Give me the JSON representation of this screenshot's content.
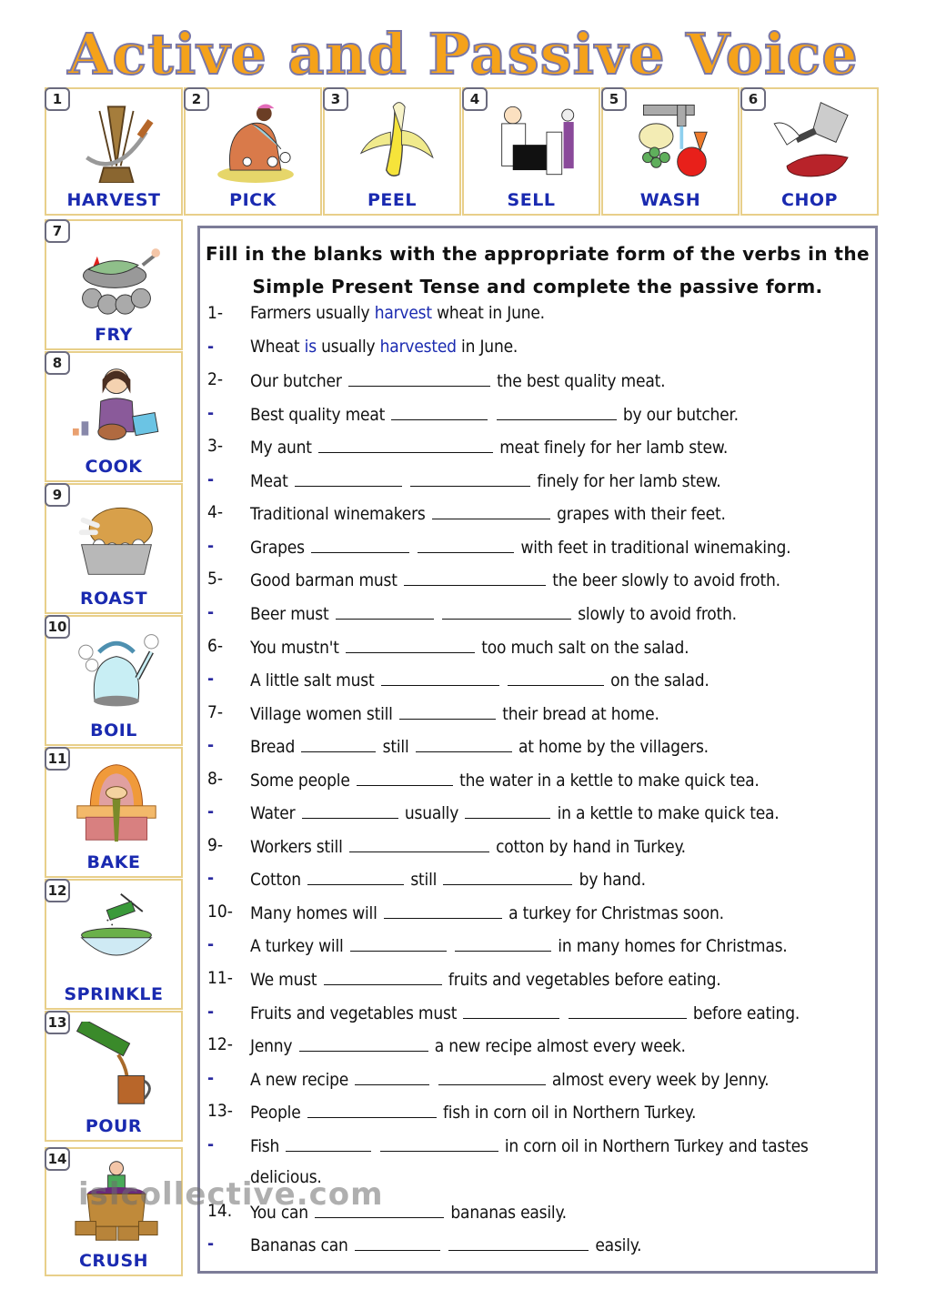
{
  "title": "Active and Passive Voice",
  "cards": [
    {
      "num": "1",
      "label": "HARVEST",
      "icon": "wheat-sickle-icon"
    },
    {
      "num": "2",
      "label": "PICK",
      "icon": "cotton-picker-icon"
    },
    {
      "num": "3",
      "label": "PEEL",
      "icon": "banana-icon"
    },
    {
      "num": "4",
      "label": "SELL",
      "icon": "butcher-shop-icon"
    },
    {
      "num": "5",
      "label": "WASH",
      "icon": "tap-vegetables-icon"
    },
    {
      "num": "6",
      "label": "CHOP",
      "icon": "cleaver-meat-icon"
    },
    {
      "num": "7",
      "label": "FRY",
      "icon": "frying-pan-fish-icon"
    },
    {
      "num": "8",
      "label": "COOK",
      "icon": "woman-cooking-icon"
    },
    {
      "num": "9",
      "label": "ROAST",
      "icon": "roast-turkey-icon"
    },
    {
      "num": "10",
      "label": "BOIL",
      "icon": "kettle-icon"
    },
    {
      "num": "11",
      "label": "BAKE",
      "icon": "oven-icon"
    },
    {
      "num": "12",
      "label": "SPRINKLE",
      "icon": "salad-bowl-icon"
    },
    {
      "num": "13",
      "label": "POUR",
      "icon": "beer-bottle-mug-icon"
    },
    {
      "num": "14",
      "label": "CRUSH",
      "icon": "grape-barrel-icon"
    }
  ],
  "instructions": {
    "line1": "Fill in the blanks with the appropriate form of the verbs in the",
    "line2": "Simple Present Tense and complete the passive form."
  },
  "exercise": [
    {
      "mark": "1-",
      "type": "active",
      "parts": [
        "Farmers usually ",
        {
          "hl": "harvest"
        },
        " wheat in June."
      ]
    },
    {
      "mark": "-",
      "type": "passive",
      "parts": [
        "Wheat ",
        {
          "hl": "is"
        },
        " usually ",
        {
          "hl": "harvested"
        },
        " in June."
      ]
    },
    {
      "mark": "2-",
      "type": "active",
      "parts": [
        "Our butcher ",
        {
          "blank": 160
        },
        " the best quality meat."
      ]
    },
    {
      "mark": "-",
      "type": "passive",
      "parts": [
        "Best quality meat ",
        {
          "blank": 110
        },
        " ",
        {
          "blank": 136
        },
        " by our butcher."
      ]
    },
    {
      "mark": "3-",
      "type": "active",
      "parts": [
        "My aunt ",
        {
          "blank": 196
        },
        " meat finely for her lamb stew."
      ]
    },
    {
      "mark": "-",
      "type": "passive",
      "parts": [
        "Meat ",
        {
          "blank": 122
        },
        " ",
        {
          "blank": 136
        },
        " finely for her lamb stew."
      ]
    },
    {
      "mark": "4-",
      "type": "active",
      "parts": [
        "Traditional winemakers ",
        {
          "blank": 134
        },
        " grapes with their feet."
      ]
    },
    {
      "mark": "-",
      "type": "passive",
      "parts": [
        "Grapes ",
        {
          "blank": 112
        },
        " ",
        {
          "blank": 110
        },
        " with feet in traditional winemaking."
      ]
    },
    {
      "mark": "5-",
      "type": "active",
      "parts": [
        "Good barman must ",
        {
          "blank": 160
        },
        " the beer slowly to avoid froth."
      ]
    },
    {
      "mark": "-",
      "type": "passive",
      "parts": [
        "Beer must ",
        {
          "blank": 112
        },
        " ",
        {
          "blank": 146
        },
        " slowly to avoid froth."
      ]
    },
    {
      "mark": "6-",
      "type": "active",
      "parts": [
        "You mustn't ",
        {
          "blank": 146
        },
        " too much salt on the salad."
      ]
    },
    {
      "mark": "-",
      "type": "passive",
      "parts": [
        "A little salt must ",
        {
          "blank": 134
        },
        " ",
        {
          "blank": 110
        },
        " on the salad."
      ]
    },
    {
      "mark": "7-",
      "type": "active",
      "parts": [
        "Village women still ",
        {
          "blank": 110
        },
        " their bread at home."
      ]
    },
    {
      "mark": "-",
      "type": "passive",
      "parts": [
        "Bread ",
        {
          "blank": 86
        },
        " still ",
        {
          "blank": 110
        },
        " at home by the villagers."
      ]
    },
    {
      "mark": "8-",
      "type": "active",
      "parts": [
        "Some people ",
        {
          "blank": 110
        },
        " the water in a kettle to make quick tea."
      ]
    },
    {
      "mark": "-",
      "type": "passive",
      "parts": [
        "Water ",
        {
          "blank": 110
        },
        " usually ",
        {
          "blank": 98
        },
        " in a kettle to make quick tea."
      ]
    },
    {
      "mark": "9-",
      "type": "active",
      "parts": [
        "Workers still ",
        {
          "blank": 158
        },
        " cotton by hand in Turkey."
      ]
    },
    {
      "mark": "-",
      "type": "passive",
      "parts": [
        "Cotton ",
        {
          "blank": 110
        },
        " still ",
        {
          "blank": 146
        },
        " by hand."
      ]
    },
    {
      "mark": "10-",
      "type": "active",
      "parts": [
        "Many homes will ",
        {
          "blank": 134
        },
        " a turkey for Christmas soon."
      ]
    },
    {
      "mark": "-",
      "type": "passive",
      "parts": [
        "A turkey will ",
        {
          "blank": 110
        },
        " ",
        {
          "blank": 110
        },
        " in many homes for Christmas."
      ]
    },
    {
      "mark": "11-",
      "type": "active",
      "parts": [
        "We must ",
        {
          "blank": 134
        },
        " fruits and vegetables before eating."
      ]
    },
    {
      "mark": "-",
      "type": "passive",
      "parts": [
        "Fruits and vegetables must ",
        {
          "blank": 110
        },
        " ",
        {
          "blank": 134
        },
        " before eating."
      ]
    },
    {
      "mark": "12-",
      "type": "active",
      "parts": [
        "Jenny ",
        {
          "blank": 146
        },
        " a new recipe almost every week."
      ]
    },
    {
      "mark": "-",
      "type": "passive",
      "parts": [
        "A new recipe ",
        {
          "blank": 86
        },
        " ",
        {
          "blank": 122
        },
        " almost every week by Jenny."
      ]
    },
    {
      "mark": "13-",
      "type": "active",
      "parts": [
        "People ",
        {
          "blank": 146
        },
        " fish in corn oil in Northern Turkey."
      ]
    },
    {
      "mark": "-",
      "type": "passive",
      "parts": [
        "Fish ",
        {
          "blank": 98
        },
        " ",
        {
          "blank": 134
        },
        " in corn oil in Northern Turkey and tastes"
      ]
    },
    {
      "mark": "",
      "type": "continuation",
      "parts": [
        "delicious."
      ]
    },
    {
      "mark": "14.",
      "type": "active",
      "parts": [
        "You can ",
        {
          "blank": 146
        },
        " bananas easily."
      ]
    },
    {
      "mark": "-",
      "type": "passive",
      "parts": [
        "Bananas can ",
        {
          "blank": 98
        },
        " ",
        {
          "blank": 158
        },
        " easily."
      ]
    }
  ],
  "watermark": "islcollective.com",
  "colors": {
    "title_fill": "#f5a21a",
    "title_outline": "#7a78a8",
    "label_blue": "#1a2ab0",
    "card_border": "#e8cf8a",
    "panel_border": "#7c7c98"
  }
}
